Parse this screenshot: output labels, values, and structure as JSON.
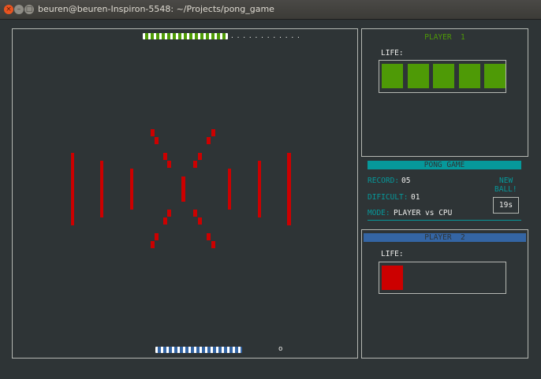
{
  "window": {
    "title": "beuren@beuren-Inspiron-5548: ~/Projects/pong_game",
    "close_glyph": "×",
    "min_glyph": "–",
    "max_glyph": "□"
  },
  "game": {
    "top_paddle_dots": ". . . . . . . . . . . .",
    "ball": "o"
  },
  "player1": {
    "title": "PLAYER  1",
    "life_label": "LIFE:",
    "lives": 5,
    "color": "#4e9a06"
  },
  "info": {
    "header": "PONG GAME",
    "record_label": "RECORD:",
    "record_value": "05",
    "dificult_label": "DIFICULT:",
    "dificult_value": "01",
    "mode_label": "MODE:",
    "mode_value": "PLAYER vs CPU",
    "new_ball_line1": "NEW",
    "new_ball_line2": "BALL!",
    "timer": "19s",
    "header_color": "#06989a"
  },
  "player2": {
    "title": "PLAYER  2",
    "life_label": "LIFE:",
    "lives": 1,
    "color": "#cc0000",
    "header_color": "#3465a4"
  }
}
